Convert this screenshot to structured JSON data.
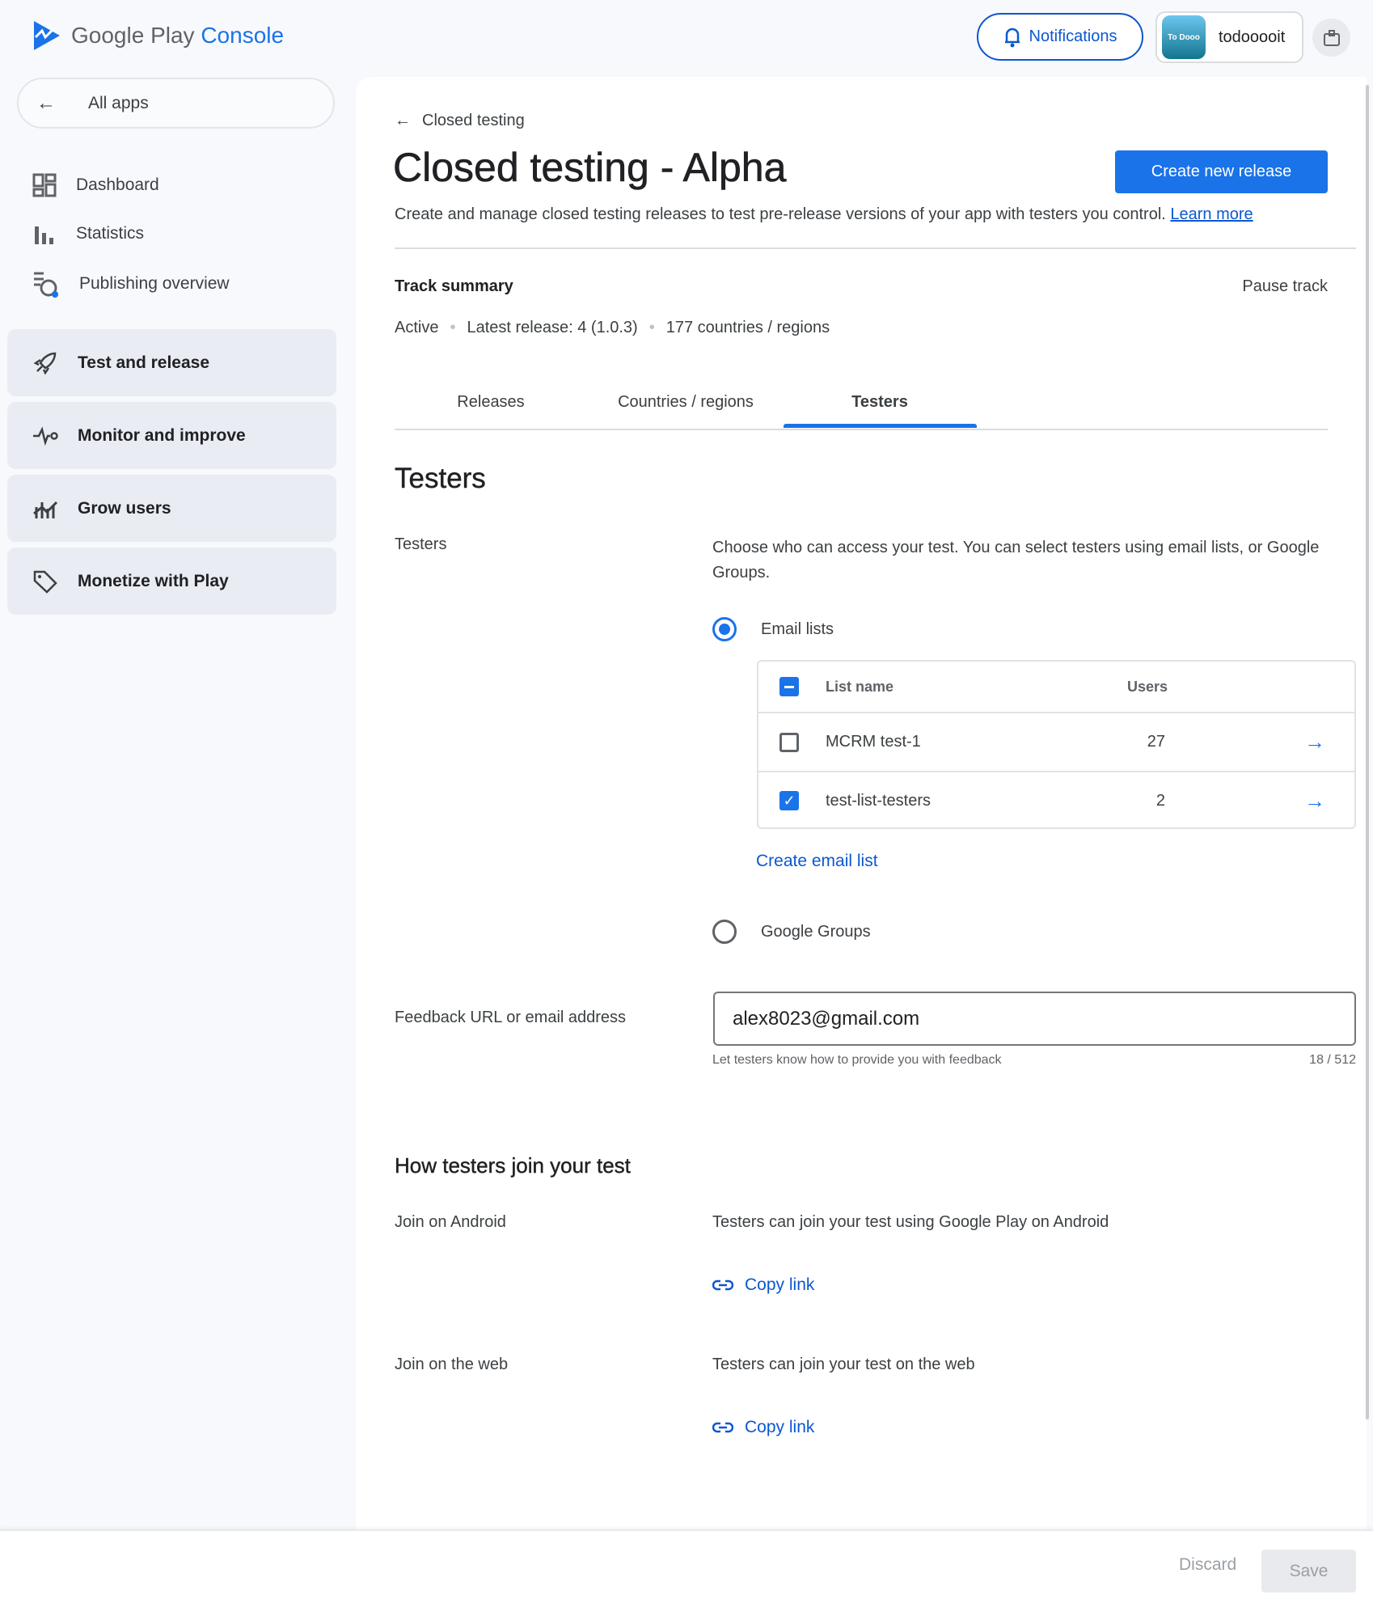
{
  "header": {
    "logo_text": "Google Play",
    "logo_accent": "Console",
    "notifications": "Notifications",
    "app_icon_text": "To Dooo",
    "account": "todooooit"
  },
  "sidebar": {
    "all_apps": "All apps",
    "items": [
      {
        "label": "Dashboard",
        "icon": "dashboard-icon"
      },
      {
        "label": "Statistics",
        "icon": "bar-chart-icon"
      },
      {
        "label": "Publishing overview",
        "icon": "publishing-icon"
      }
    ],
    "groups": [
      {
        "label": "Test and release",
        "icon": "rocket-icon"
      },
      {
        "label": "Monitor and improve",
        "icon": "pulse-icon"
      },
      {
        "label": "Grow users",
        "icon": "growth-icon"
      },
      {
        "label": "Monetize with Play",
        "icon": "tag-icon"
      }
    ]
  },
  "page": {
    "back": "Closed testing",
    "title": "Closed testing - Alpha",
    "create_release": "Create new release",
    "description": "Create and manage closed testing releases to test pre-release versions of your app with testers you control.",
    "learn_more": "Learn more",
    "track_summary": "Track summary",
    "pause_track": "Pause track",
    "status": "Active",
    "latest_release": "Latest release: 4 (1.0.3)",
    "countries": "177 countries / regions",
    "tabs": [
      {
        "label": "Releases"
      },
      {
        "label": "Countries / regions"
      },
      {
        "label": "Testers",
        "active": true
      }
    ]
  },
  "testers": {
    "heading": "Testers",
    "label": "Testers",
    "description": "Choose who can access your test. You can select testers using email lists, or Google Groups.",
    "option_email": "Email lists",
    "option_groups": "Google Groups",
    "selected": "Email lists",
    "table": {
      "col_name": "List name",
      "col_users": "Users",
      "rows": [
        {
          "name": "MCRM test-1",
          "users": "27",
          "checked": false
        },
        {
          "name": "test-list-testers",
          "users": "2",
          "checked": true
        }
      ]
    },
    "create_list": "Create email list",
    "feedback_label": "Feedback URL or email address",
    "feedback_value": "alex8023@gmail.com",
    "feedback_helper": "Let testers know how to provide you with feedback",
    "feedback_count": "18 / 512"
  },
  "join": {
    "heading": "How testers join your test",
    "android_label": "Join on Android",
    "android_desc": "Testers can join your test using Google Play on Android",
    "web_label": "Join on the web",
    "web_desc": "Testers can join your test on the web",
    "copy_link": "Copy link"
  },
  "footer": {
    "discard": "Discard",
    "save": "Save"
  },
  "colors": {
    "accent": "#1a73e8",
    "link": "#0b57d0"
  }
}
